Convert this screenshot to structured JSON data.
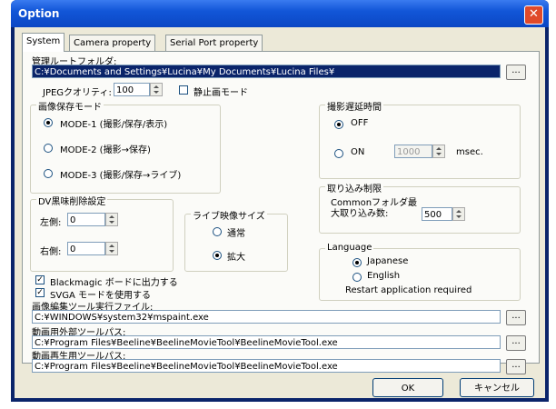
{
  "window": {
    "title": "Option",
    "close_glyph": "✕"
  },
  "tabs": [
    {
      "label": "System"
    },
    {
      "label": "Camera property"
    },
    {
      "label": "Serial Port property"
    }
  ],
  "root_folder": {
    "label": "管理ルートフォルダ:",
    "value": "C:¥Documents and Settings¥Lucina¥My Documents¥Lucina Files¥",
    "browse_label": "..."
  },
  "jpeg": {
    "label": "JPEGクオリティ:",
    "value": "100",
    "still_label": "静止画モード"
  },
  "save_mode": {
    "title": "画像保存モード",
    "options": [
      {
        "label": "MODE-1 (撮影/保存/表示)",
        "selected": true
      },
      {
        "label": "MODE-2 (撮影→保存)",
        "selected": false
      },
      {
        "label": "MODE-3 (撮影/保存→ライブ)",
        "selected": false
      }
    ]
  },
  "delay": {
    "title": "撮影遅延時間",
    "off_label": "OFF",
    "on_label": "ON",
    "value": "1000",
    "unit": "msec."
  },
  "dv_edge": {
    "title": "DV黒味削除設定",
    "left_label": "左側:",
    "left_value": "0",
    "right_label": "右側:",
    "right_value": "0"
  },
  "live_size": {
    "title": "ライブ映像サイズ",
    "normal_label": "通常",
    "zoom_label": "拡大"
  },
  "import_limit": {
    "title": "取り込み制限",
    "line1": "Commonフォルダ最",
    "line2": "大取り込み数:",
    "value": "500"
  },
  "language": {
    "title": "Language",
    "japanese": "Japanese",
    "english": "English",
    "note": "Restart application required"
  },
  "checks": {
    "blackmagic": "Blackmagic ボードに出力する",
    "svga": "SVGA モードを使用する"
  },
  "tools": [
    {
      "label": "画像編集ツール実行ファイル:",
      "value": "C:¥WINDOWS¥system32¥mspaint.exe"
    },
    {
      "label": "動画用外部ツールパス:",
      "value": "C:¥Program Files¥Beeline¥BeelineMovieTool¥BeelineMovieTool.exe"
    },
    {
      "label": "動画再生用ツールパス:",
      "value": "C:¥Program Files¥Beeline¥BeelineMovieTool¥BeelineMovieTool.exe"
    }
  ],
  "buttons": {
    "ok": "OK",
    "cancel": "キャンセル",
    "browse": "..."
  }
}
